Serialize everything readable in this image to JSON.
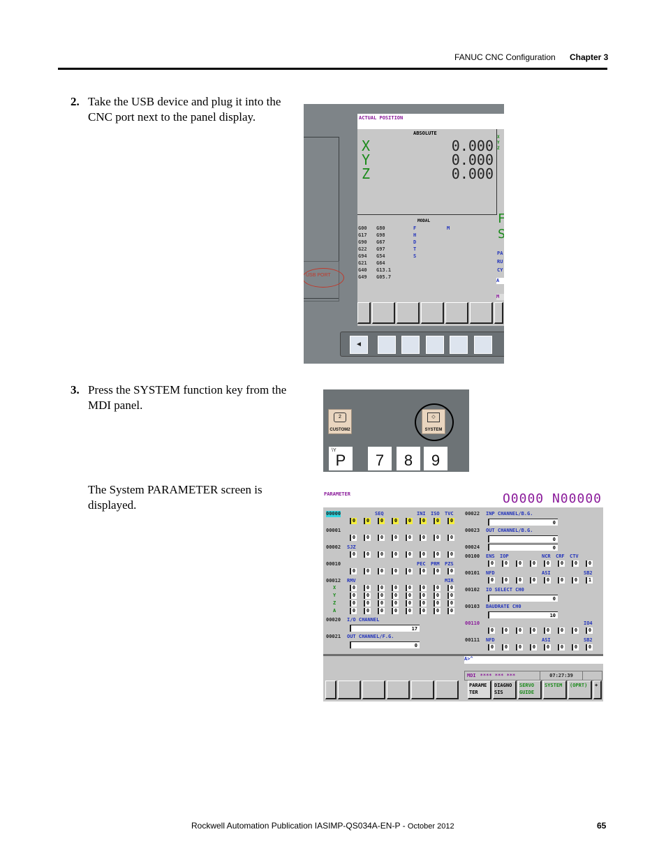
{
  "header": {
    "section_title": "FANUC CNC Configuration",
    "chapter": "Chapter 3"
  },
  "steps": [
    {
      "number": "2.",
      "text": "Take the USB device and plug it into the CNC port next to the panel display."
    },
    {
      "number": "3.",
      "text": "Press the SYSTEM function key from the MDI panel."
    }
  ],
  "result_text": "The System PARAMETER screen is displayed.",
  "figure1": {
    "usb_label": "USB PORT",
    "screen_title": "ACTUAL POSITION",
    "absolute_label": "ABSOLUTE",
    "axes": [
      {
        "axis": "X",
        "value": "0.000"
      },
      {
        "axis": "Y",
        "value": "0.000"
      },
      {
        "axis": "Z",
        "value": "0.000"
      }
    ],
    "modal_label": "MODAL",
    "gcodes_col1": [
      "G00",
      "G17",
      "G90",
      "G22",
      "G94",
      "G21",
      "G40",
      "G49"
    ],
    "gcodes_col2": [
      "G80",
      "G98",
      "G67",
      "G97",
      "G54",
      "G64",
      "G13.1",
      "G05.7"
    ],
    "modal_letters": [
      "F",
      "H",
      "D",
      "T",
      "S"
    ],
    "modal_m": "M",
    "right_partial": {
      "big1": "F",
      "big2": "S",
      "small": [
        "PA",
        "RU",
        "CY"
      ],
      "cmd": "A",
      "mode": "M",
      "xyz": [
        "X",
        "Y",
        "Z"
      ]
    },
    "back_key": "◄"
  },
  "figure2": {
    "custom_key": {
      "label": "CUSTOM2",
      "icon_text": "2"
    },
    "system_key": {
      "label": "SYSTEM"
    },
    "number_keys": [
      {
        "main": "P",
        "sub": "\\Y"
      },
      {
        "main": "7"
      },
      {
        "main": "8"
      },
      {
        "main": "9"
      }
    ]
  },
  "figure3": {
    "title": "PARAMETER",
    "program": "O0000 N00000",
    "left": {
      "p00000": {
        "num": "00000",
        "labels": [
          "SEQ",
          "INI",
          "ISO",
          "TVC"
        ],
        "bits": [
          "0",
          "0",
          "0",
          "0",
          "0",
          "0",
          "0",
          "0"
        ]
      },
      "p00001": {
        "num": "00001",
        "bits": [
          "0",
          "0",
          "0",
          "0",
          "0",
          "0",
          "0",
          "0"
        ]
      },
      "p00002": {
        "num": "00002",
        "label": "SJZ",
        "bits": [
          "0",
          "0",
          "0",
          "0",
          "0",
          "0",
          "0",
          "0"
        ]
      },
      "p00010": {
        "num": "00010",
        "labels": [
          "PEC",
          "PRM",
          "PZS"
        ],
        "bits": [
          "0",
          "0",
          "0",
          "0",
          "0",
          "0",
          "0",
          "0"
        ]
      },
      "p00012": {
        "num": "00012",
        "labels": [
          "RMV",
          "MIR"
        ],
        "axes": [
          "X",
          "Y",
          "Z",
          "A"
        ],
        "bits": [
          "0",
          "0",
          "0",
          "0",
          "0",
          "0",
          "0",
          "0"
        ]
      },
      "p00020": {
        "num": "00020",
        "label": "I/O CHANNEL",
        "value": "17"
      },
      "p00021": {
        "num": "00021",
        "label": "OUT CHANNEL/F.G.",
        "value": "0"
      }
    },
    "right": {
      "p00022": {
        "num": "00022",
        "label": "INP CHANNEL/B.G.",
        "value": "0"
      },
      "p00023": {
        "num": "00023",
        "label": "OUT CHANNEL/B.G.",
        "value": "0"
      },
      "p00024": {
        "num": "00024",
        "value": "0"
      },
      "p00100": {
        "num": "00100",
        "labels": [
          "ENS",
          "IOP",
          "NCR",
          "CRF",
          "CTV"
        ],
        "bits": [
          "0",
          "0",
          "0",
          "0",
          "0",
          "0",
          "0",
          "0"
        ]
      },
      "p00101": {
        "num": "00101",
        "labels": [
          "NFD",
          "ASI",
          "SB2"
        ],
        "bits": [
          "0",
          "0",
          "0",
          "0",
          "0",
          "0",
          "0",
          "1"
        ]
      },
      "p00102": {
        "num": "00102",
        "label": "IO SELECT CH0",
        "value": "0"
      },
      "p00103": {
        "num": "00103",
        "label": "BAUDRATE CH0",
        "value": "10"
      },
      "p00110": {
        "num": "00110",
        "label": "IO4",
        "bits": [
          "0",
          "0",
          "0",
          "0",
          "0",
          "0",
          "0",
          "0"
        ]
      },
      "p00111": {
        "num": "00111",
        "labels": [
          "NFD",
          "ASI",
          "SB2"
        ],
        "bits": [
          "0",
          "0",
          "0",
          "0",
          "0",
          "0",
          "0",
          "0"
        ]
      }
    },
    "command_line": "A>^",
    "status": {
      "mode": "MDI",
      "stars": "**** *** ***",
      "time": "07:27:39"
    },
    "softkeys": [
      "PARAME\nTER",
      "DIAGNO\nSIS",
      "SERVO\nGUIDE",
      "SYSTEM",
      "(OPRT)",
      "+"
    ]
  },
  "footer": {
    "publication": "Rockwell Automation Publication IASIMP-QS034A-EN-P - ",
    "date": "October 2012",
    "page": "65"
  }
}
